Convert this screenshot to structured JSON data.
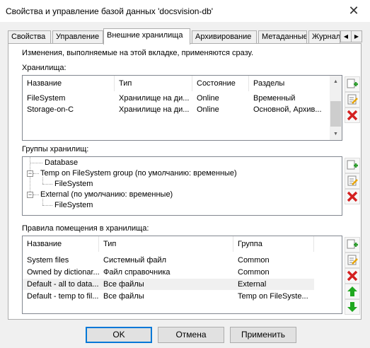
{
  "window": {
    "title": "Свойства и управление базой данных 'docsvision-db'",
    "close_glyph": "✕"
  },
  "tabs": [
    {
      "label": "Свойства"
    },
    {
      "label": "Управление"
    },
    {
      "label": "Внешние хранилища"
    },
    {
      "label": "Архивирование"
    },
    {
      "label": "Метаданные"
    },
    {
      "label": "Журнал"
    }
  ],
  "tab_scroll": {
    "left": "◀",
    "right": "▶"
  },
  "info_text": "Изменения, выполняемые на этой вкладке, применяются сразу.",
  "storages": {
    "label": "Хранилища:",
    "columns": [
      "Название",
      "Тип",
      "Состояние",
      "Разделы"
    ],
    "rows": [
      [
        "FileSystem",
        "Хранилище на ди...",
        "Online",
        "Временный"
      ],
      [
        "Storage-on-C",
        "Хранилище на ди...",
        "Online",
        "Основной, Архив..."
      ]
    ],
    "scroll": {
      "up": "▲",
      "down": "▼"
    }
  },
  "groups": {
    "label": "Группы хранилищ:",
    "items": [
      {
        "text": "Database",
        "minus": ""
      },
      {
        "text": "Temp on FileSystem group (по умолчанию: временные)",
        "minus": "−"
      },
      {
        "text": "FileSystem",
        "minus": ""
      },
      {
        "text": "External (по умолчанию: временные)",
        "minus": "−"
      },
      {
        "text": "FileSystem",
        "minus": ""
      }
    ]
  },
  "rules": {
    "label": "Правила помещения в хранилища:",
    "columns": [
      "Название",
      "Тип",
      "Группа"
    ],
    "rows": [
      [
        "System files",
        "Системный файл",
        "Common"
      ],
      [
        "Owned by dictionar...",
        "Файл справочника",
        "Common"
      ],
      [
        "Default - all to data...",
        "Все файлы",
        "External"
      ],
      [
        "Default - temp to fil...",
        "Все файлы",
        "Temp on FileSyste..."
      ]
    ]
  },
  "side_buttons": {
    "add": "add-icon",
    "edit": "edit-icon",
    "delete": "delete-icon",
    "up": "move-up-icon",
    "down": "move-down-icon"
  },
  "buttons": {
    "ok": "OK",
    "cancel": "Отмена",
    "apply": "Применить"
  },
  "colors": {
    "add_green": "#2e9e2e",
    "delete_red": "#d42020",
    "focus_blue": "#0078d7",
    "arrow_green": "#1fa81f"
  }
}
